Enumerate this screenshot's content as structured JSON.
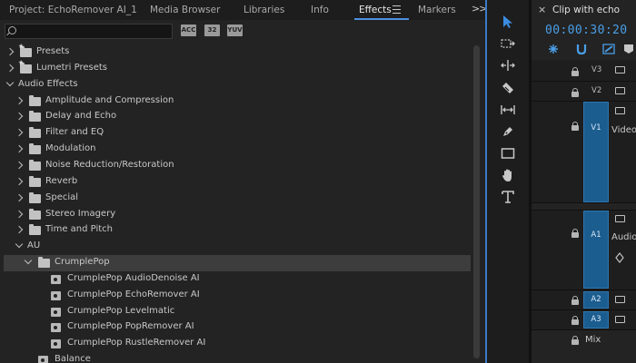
{
  "effects_panel": {
    "tabs": [
      {
        "label": "Project: EchoRemover AI_1",
        "active": false
      },
      {
        "label": "Media Browser",
        "active": false
      },
      {
        "label": "Libraries",
        "active": false
      },
      {
        "label": "Info",
        "active": false
      },
      {
        "label": "Effects",
        "active": true
      },
      {
        "label": "Markers",
        "active": false
      }
    ],
    "overflow_label": ">>",
    "search": {
      "value": "",
      "placeholder": ""
    },
    "filter_buttons": [
      {
        "label": "ACC",
        "icon": "accelerated-effects-icon"
      },
      {
        "label": "32",
        "icon": "32-bit-color-icon"
      },
      {
        "label": "YUV",
        "icon": "yuv-effects-icon"
      }
    ],
    "tree": [
      {
        "label": "Presets",
        "level": 0,
        "expand": "collapsed",
        "icon": "folder-star"
      },
      {
        "label": "Lumetri Presets",
        "level": 0,
        "expand": "collapsed",
        "icon": "folder-star"
      },
      {
        "label": "Audio Effects",
        "level": 0,
        "expand": "expanded",
        "icon": "none"
      },
      {
        "label": "Amplitude and Compression",
        "level": 1,
        "expand": "collapsed",
        "icon": "folder"
      },
      {
        "label": "Delay and Echo",
        "level": 1,
        "expand": "collapsed",
        "icon": "folder"
      },
      {
        "label": "Filter and EQ",
        "level": 1,
        "expand": "collapsed",
        "icon": "folder"
      },
      {
        "label": "Modulation",
        "level": 1,
        "expand": "collapsed",
        "icon": "folder"
      },
      {
        "label": "Noise Reduction/Restoration",
        "level": 1,
        "expand": "collapsed",
        "icon": "folder"
      },
      {
        "label": "Reverb",
        "level": 1,
        "expand": "collapsed",
        "icon": "folder"
      },
      {
        "label": "Special",
        "level": 1,
        "expand": "collapsed",
        "icon": "folder"
      },
      {
        "label": "Stereo Imagery",
        "level": 1,
        "expand": "collapsed",
        "icon": "folder"
      },
      {
        "label": "Time and Pitch",
        "level": 1,
        "expand": "collapsed",
        "icon": "folder"
      },
      {
        "label": "AU",
        "level": 1,
        "expand": "expanded",
        "icon": "none"
      },
      {
        "label": "CrumplePop",
        "level": 2,
        "expand": "expanded",
        "icon": "folder",
        "selected": true
      },
      {
        "label": "CrumplePop AudioDenoise AI",
        "level": 3,
        "expand": "none",
        "icon": "effect"
      },
      {
        "label": "CrumplePop EchoRemover AI",
        "level": 3,
        "expand": "none",
        "icon": "effect"
      },
      {
        "label": "CrumplePop Levelmatic",
        "level": 3,
        "expand": "none",
        "icon": "effect"
      },
      {
        "label": "CrumplePop PopRemover AI",
        "level": 3,
        "expand": "none",
        "icon": "effect"
      },
      {
        "label": "CrumplePop RustleRemover AI",
        "level": 3,
        "expand": "none",
        "icon": "effect"
      },
      {
        "label": "Balance",
        "level": 2,
        "expand": "none",
        "icon": "effect"
      }
    ]
  },
  "tools_panel": {
    "tools": [
      {
        "name": "selection-tool",
        "active": true
      },
      {
        "name": "track-select-tool",
        "active": false
      },
      {
        "name": "ripple-edit-tool",
        "active": false
      },
      {
        "name": "razor-tool",
        "active": false
      },
      {
        "name": "slip-tool",
        "active": false
      },
      {
        "name": "pen-tool",
        "active": false
      },
      {
        "name": "rectangle-tool",
        "active": false
      },
      {
        "name": "hand-tool",
        "active": false
      },
      {
        "name": "type-tool",
        "active": false
      }
    ]
  },
  "timeline": {
    "close_label": "×",
    "title": "Clip with echo",
    "timecode": "00:00:30:20",
    "tracks": [
      {
        "id": "V3",
        "label": "V3",
        "targeted": false,
        "name": ""
      },
      {
        "id": "V2",
        "label": "V2",
        "targeted": false,
        "name": ""
      },
      {
        "id": "V1",
        "label": "V1",
        "targeted": true,
        "name": "Video"
      },
      {
        "id": "A1",
        "label": "A1",
        "targeted": true,
        "name": "Audio"
      },
      {
        "id": "A2",
        "label": "A2",
        "targeted": true,
        "name": ""
      },
      {
        "id": "A3",
        "label": "A3",
        "targeted": true,
        "name": ""
      }
    ],
    "mix_label": "Mix"
  },
  "colors": {
    "accent": "#4d8fe0",
    "timecode": "#4a9ee8",
    "track_target": "#1c5d8f",
    "selected_row": "#3d3d3d",
    "panel_bg": "#232323"
  }
}
